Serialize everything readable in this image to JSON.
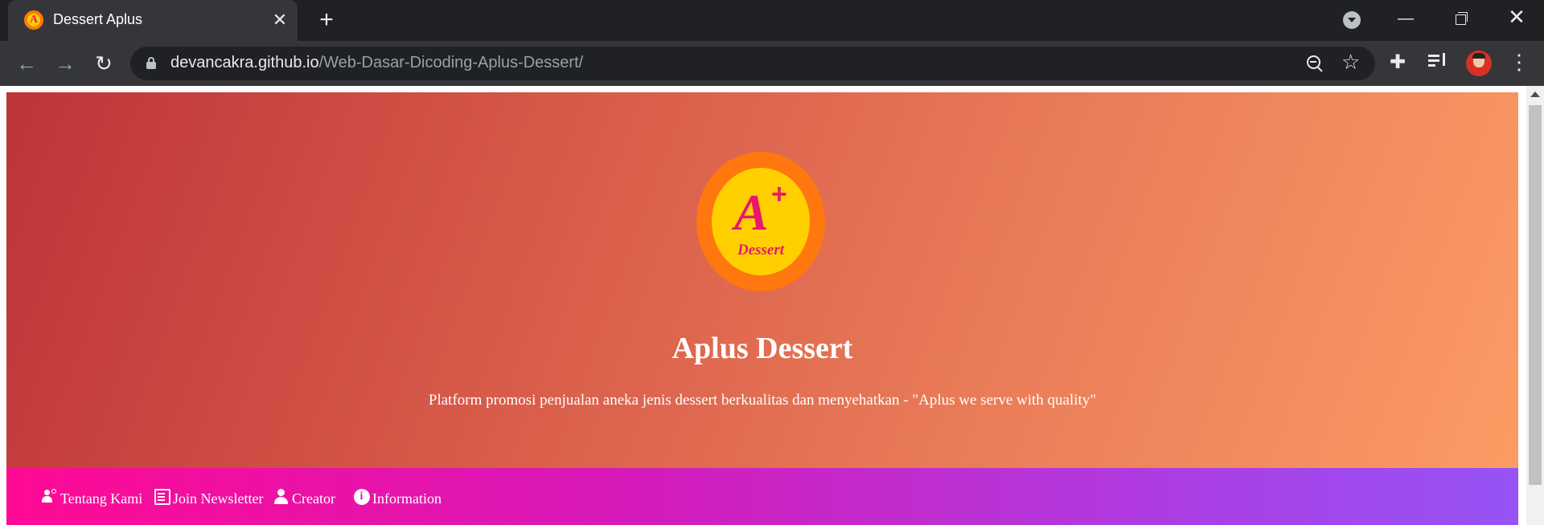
{
  "browser": {
    "tab_title": "Dessert Aplus",
    "tab_close_glyph": "✕",
    "new_tab_glyph": "+",
    "favicon_letter": "A",
    "url_domain": "devancakra.github.io",
    "url_path": "/Web-Dasar-Dicoding-Aplus-Dessert/",
    "back_glyph": "←",
    "forward_glyph": "→",
    "reload_glyph": "↻",
    "star_glyph": "☆",
    "extensions_glyph": "✚",
    "menu_glyph": "⋮",
    "minimize_glyph": "—",
    "close_glyph": "✕"
  },
  "hero": {
    "logo": {
      "letter": "A",
      "plus": "+",
      "text": "Dessert"
    },
    "title": "Aplus Dessert",
    "tagline": "Platform promosi penjualan aneka jenis dessert berkualitas dan menyehatkan - \"Aplus we serve with quality\""
  },
  "nav": {
    "items": [
      {
        "label": "Tentang Kami",
        "icon": "group-icon"
      },
      {
        "label": "Join Newsletter",
        "icon": "newspaper-icon"
      },
      {
        "label": "Creator",
        "icon": "person-icon"
      },
      {
        "label": "Information",
        "icon": "info-icon"
      }
    ],
    "info_glyph": "i"
  },
  "colors": {
    "hero_gradient_start": "#bd3439",
    "hero_gradient_end": "#fd9b64",
    "nav_gradient_start": "#ff0a94",
    "nav_gradient_end": "#9653f5",
    "logo_outer": "#ff770f",
    "logo_inner": "#ffcf00",
    "logo_text": "#e6196f"
  }
}
